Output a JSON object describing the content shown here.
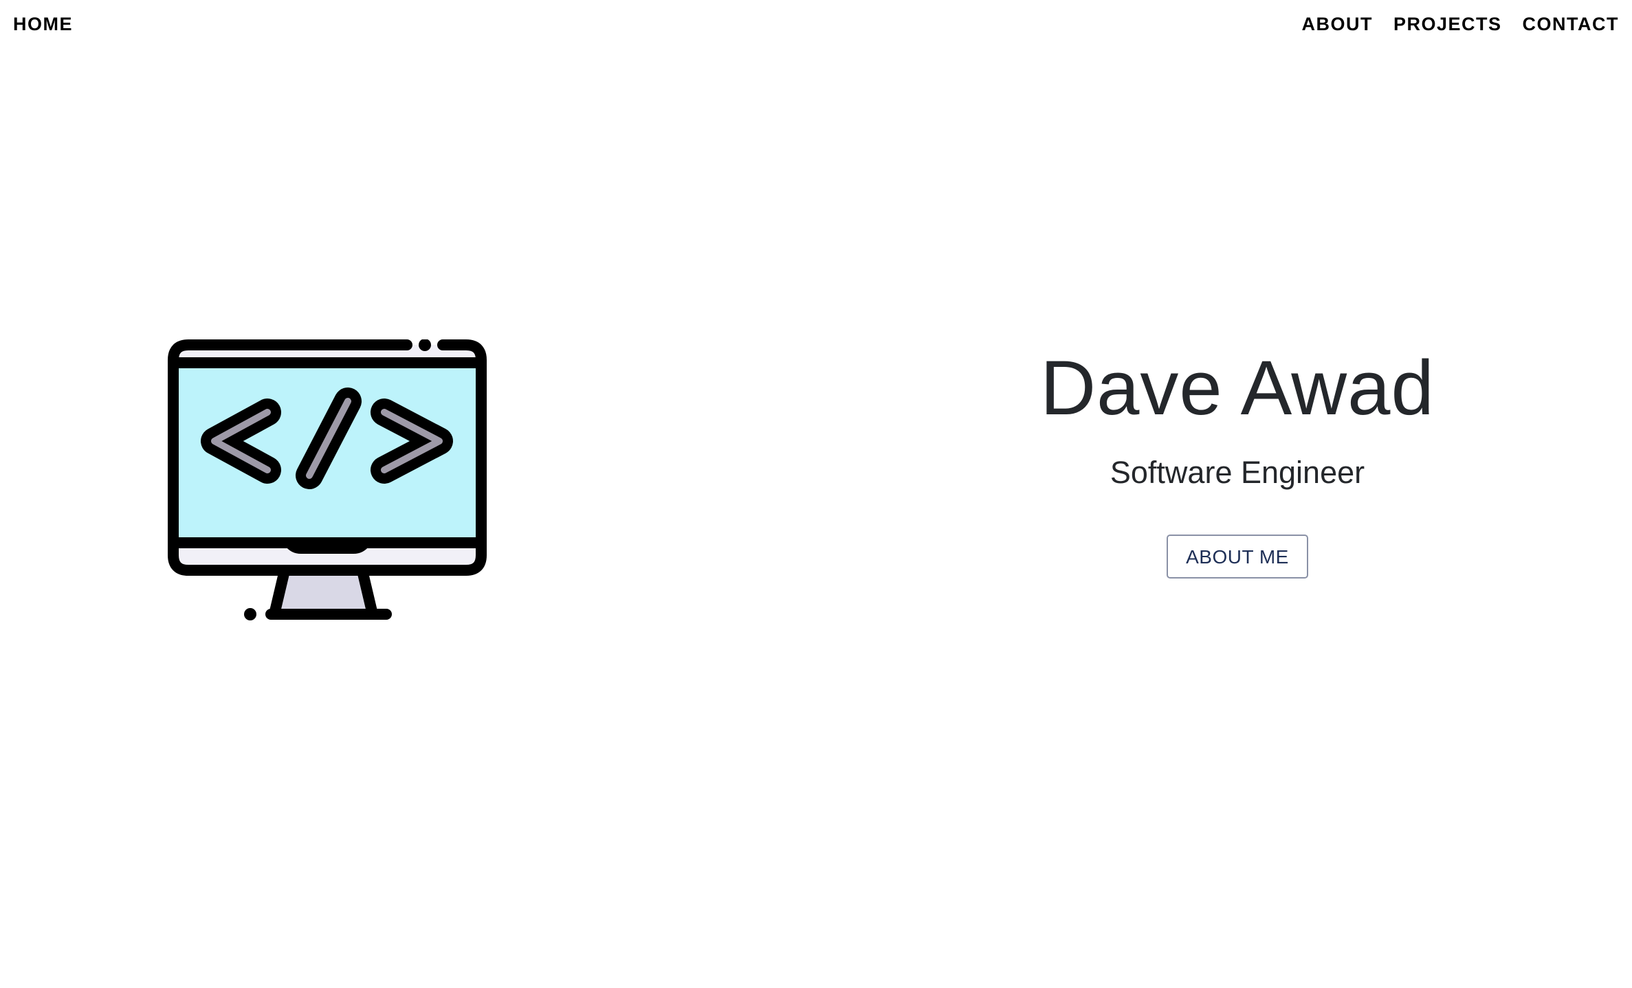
{
  "nav": {
    "home_label": "HOME",
    "links": [
      {
        "label": "ABOUT"
      },
      {
        "label": "PROJECTS"
      },
      {
        "label": "CONTACT"
      }
    ]
  },
  "hero": {
    "illustration_icon": "monitor-code-icon",
    "name": "Dave Awad",
    "role": "Software Engineer",
    "button_label": "ABOUT ME"
  },
  "colors": {
    "background": "#ffffff",
    "text": "#24272b",
    "screen": "#bdf3fb",
    "stand": "#d9d8e6",
    "button_text": "#1e2f56",
    "button_border": "#8a91a6"
  }
}
